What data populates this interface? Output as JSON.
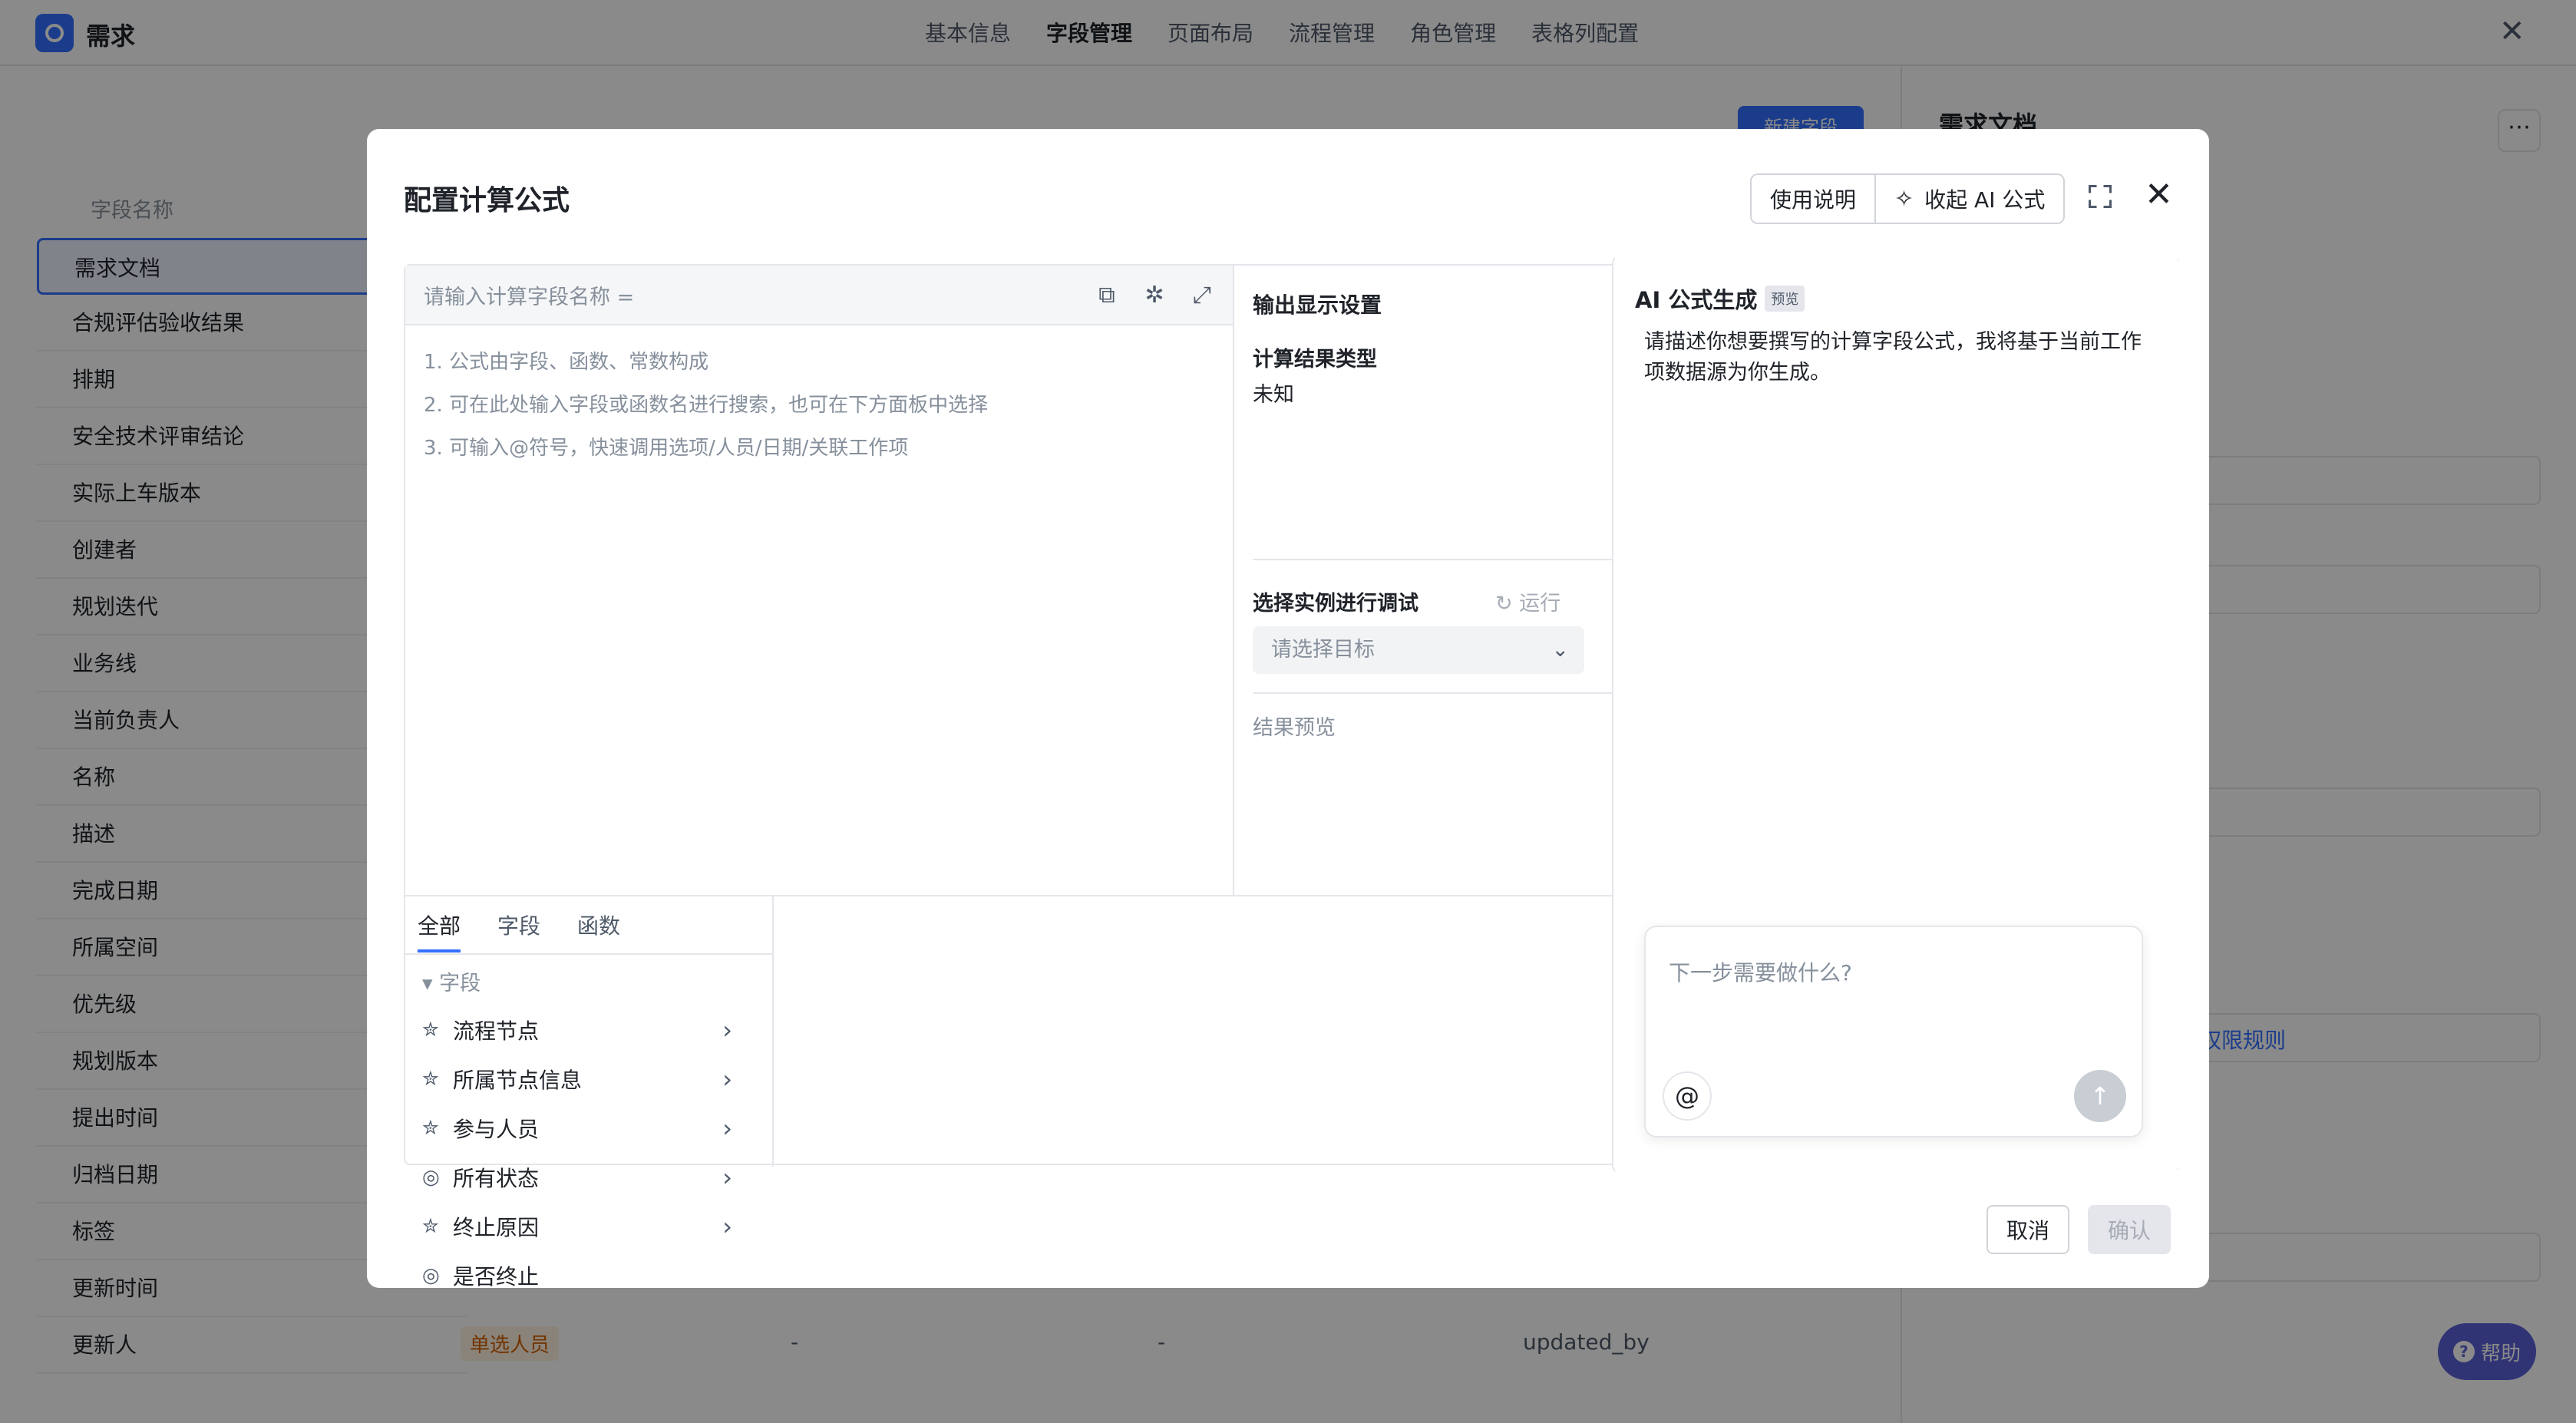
{
  "app": {
    "title": "需求",
    "nav": [
      "基本信息",
      "字段管理",
      "页面布局",
      "流程管理",
      "角色管理",
      "表格列配置"
    ],
    "close_label": "✕"
  },
  "field_list": {
    "column_label": "字段名称",
    "items": [
      "需求文档",
      "合规评估验收结果",
      "排期",
      "安全技术评审结论",
      "实际上车版本",
      "创建者",
      "规划迭代",
      "业务线",
      "当前负责人",
      "名称",
      "描述",
      "完成日期",
      "所属空间",
      "优先级",
      "规划版本",
      "提出时间",
      "归档日期",
      "标签",
      "更新时间",
      "更新人"
    ]
  },
  "background": {
    "last_row_tag": "单选人员",
    "last_row_dash1": "-",
    "last_row_dash2": "-",
    "last_row_key": "updated_by",
    "new_field_label": "新建字段",
    "right_title": "需求文档",
    "permission_link": "权限规则",
    "help_label": "帮助"
  },
  "modal": {
    "title": "配置计算公式",
    "usage_button": "使用说明",
    "collapse_ai_button": "收起 AI 公式",
    "editor": {
      "name_placeholder": "请输入计算字段名称 =",
      "hints": [
        "1. 公式由字段、函数、常数构成",
        "2. 可在此处输入字段或函数名进行搜索，也可在下方面板中选择",
        "3. 可输入@符号，快速调用选项/人员/日期/关联工作项"
      ]
    },
    "output": {
      "title": "输出显示设置",
      "type_label": "计算结果类型",
      "type_value": "未知",
      "debug_label": "选择实例进行调试",
      "run_label": "运行",
      "target_placeholder": "请选择目标",
      "result_label": "结果预览"
    },
    "tabs": [
      "全部",
      "字段",
      "函数"
    ],
    "tree": {
      "group_label": "字段",
      "items": [
        {
          "label": "流程节点",
          "icon": "node-icon",
          "has_children": true
        },
        {
          "label": "所属节点信息",
          "icon": "node-icon",
          "has_children": true
        },
        {
          "label": "参与人员",
          "icon": "node-icon",
          "has_children": true
        },
        {
          "label": "所有状态",
          "icon": "check-circle-icon",
          "has_children": true
        },
        {
          "label": "终止原因",
          "icon": "node-icon",
          "has_children": true
        },
        {
          "label": "是否终止",
          "icon": "check-circle-icon",
          "has_children": false
        }
      ]
    },
    "ai": {
      "title": "AI 公式生成",
      "badge": "预览",
      "description": "请描述你想要撰写的计算字段公式，我将基于当前工作项数据源为你生成。",
      "input_placeholder": "下一步需要做什么?"
    },
    "cancel_label": "取消",
    "confirm_label": "确认"
  },
  "colors": {
    "accent": "#3370ff",
    "overlay": "rgba(0,0,0,0.46)",
    "help": "#5b61d6"
  }
}
